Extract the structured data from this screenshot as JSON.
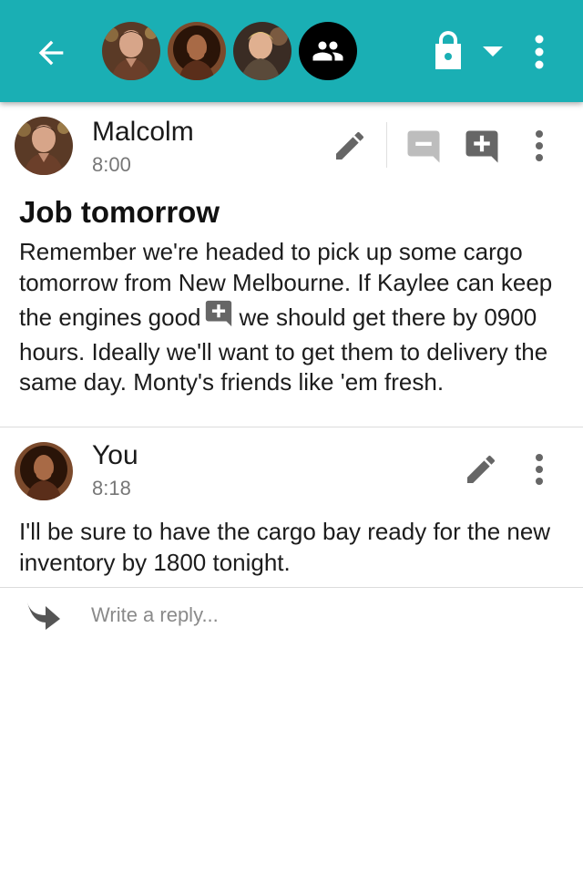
{
  "colors": {
    "accent": "#1aafb4",
    "icon_dark": "#666666",
    "icon_light": "#bdbdbd"
  },
  "appbar": {
    "back_icon": "arrow-left-icon",
    "participants": [
      "Malcolm",
      "You",
      "Wash"
    ],
    "group_icon": "group-icon",
    "lock_icon": "lock-icon",
    "menu_icon": "more-vert-icon"
  },
  "messages": [
    {
      "author": "Malcolm",
      "time": "8:00",
      "subject": "Job tomorrow",
      "body_before": "Remember we're headed to pick up some cargo tomorrow from New Melbourne.  If Kaylee can keep the engines good",
      "body_after": "we should get there by 0900 hours.  Ideally we'll want to get them to delivery the same day.  Monty's friends like 'em fresh.",
      "actions": [
        "edit-icon",
        "comment-minus-icon",
        "comment-plus-icon",
        "more-vert-icon"
      ]
    },
    {
      "author": "You",
      "time": "8:18",
      "body": "I'll be sure to have the cargo bay ready for the new inventory by 1800 tonight.",
      "actions": [
        "edit-icon",
        "more-vert-icon"
      ]
    }
  ],
  "reply": {
    "placeholder": "Write a reply...",
    "icon": "reply-arrow-icon"
  }
}
